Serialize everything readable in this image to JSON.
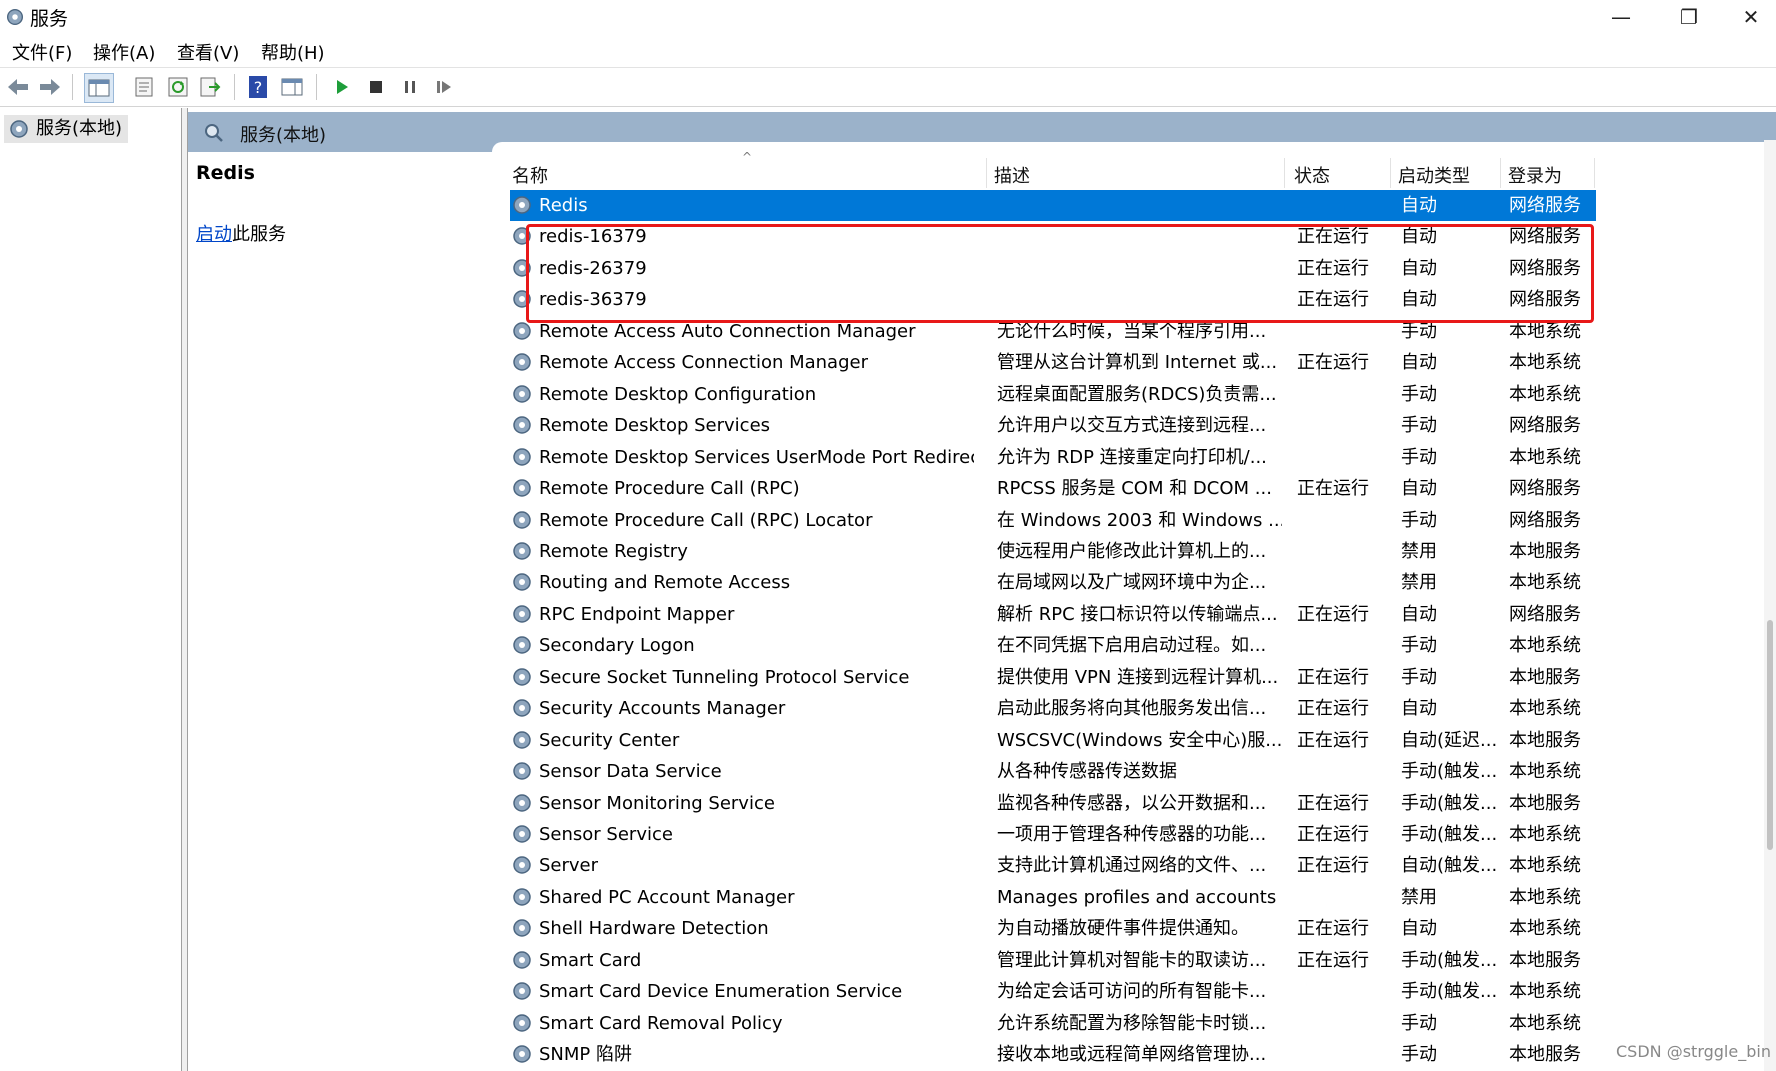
{
  "window": {
    "title": "服务",
    "minimize_glyph": "—",
    "restore_glyph": "❐",
    "close_glyph": "✕"
  },
  "menu": [
    "文件(F)",
    "操作(A)",
    "查看(V)",
    "帮助(H)"
  ],
  "toolbar_icons": [
    "back-icon",
    "forward-icon",
    "console-tree-icon",
    "properties-icon",
    "refresh-icon",
    "export-list-icon",
    "help-icon",
    "action-pane-icon",
    "start-service-icon",
    "stop-service-icon",
    "pause-service-icon",
    "resume-service-icon"
  ],
  "tree": {
    "root_label": "服务(本地)"
  },
  "pane": {
    "header_label": "服务(本地)"
  },
  "description": {
    "selected_service": "Redis",
    "action_link": "启动",
    "action_suffix": "此服务"
  },
  "columns": {
    "name": "名称",
    "desc": "描述",
    "status": "状态",
    "startup": "启动类型",
    "logon": "登录为"
  },
  "sort_indicator": "^",
  "services": [
    {
      "name": "Redis",
      "desc": "",
      "status": "",
      "startup": "自动",
      "logon": "网络服务",
      "selected": true
    },
    {
      "name": "redis-16379",
      "desc": "",
      "status": "正在运行",
      "startup": "自动",
      "logon": "网络服务"
    },
    {
      "name": "redis-26379",
      "desc": "",
      "status": "正在运行",
      "startup": "自动",
      "logon": "网络服务"
    },
    {
      "name": "redis-36379",
      "desc": "",
      "status": "正在运行",
      "startup": "自动",
      "logon": "网络服务"
    },
    {
      "name": "Remote Access Auto Connection Manager",
      "desc": "无论什么时候，当某个程序引用...",
      "status": "",
      "startup": "手动",
      "logon": "本地系统"
    },
    {
      "name": "Remote Access Connection Manager",
      "desc": "管理从这台计算机到 Internet 或...",
      "status": "正在运行",
      "startup": "自动",
      "logon": "本地系统"
    },
    {
      "name": "Remote Desktop Configuration",
      "desc": "远程桌面配置服务(RDCS)负责需...",
      "status": "",
      "startup": "手动",
      "logon": "本地系统"
    },
    {
      "name": "Remote Desktop Services",
      "desc": "允许用户以交互方式连接到远程...",
      "status": "",
      "startup": "手动",
      "logon": "网络服务"
    },
    {
      "name": "Remote Desktop Services UserMode Port Redirector",
      "desc": "允许为 RDP 连接重定向打印机/...",
      "status": "",
      "startup": "手动",
      "logon": "本地系统"
    },
    {
      "name": "Remote Procedure Call (RPC)",
      "desc": "RPCSS 服务是 COM 和 DCOM ...",
      "status": "正在运行",
      "startup": "自动",
      "logon": "网络服务"
    },
    {
      "name": "Remote Procedure Call (RPC) Locator",
      "desc": "在 Windows 2003 和 Windows ...",
      "status": "",
      "startup": "手动",
      "logon": "网络服务"
    },
    {
      "name": "Remote Registry",
      "desc": "使远程用户能修改此计算机上的...",
      "status": "",
      "startup": "禁用",
      "logon": "本地服务"
    },
    {
      "name": "Routing and Remote Access",
      "desc": "在局域网以及广域网环境中为企...",
      "status": "",
      "startup": "禁用",
      "logon": "本地系统"
    },
    {
      "name": "RPC Endpoint Mapper",
      "desc": "解析 RPC 接口标识符以传输端点...",
      "status": "正在运行",
      "startup": "自动",
      "logon": "网络服务"
    },
    {
      "name": "Secondary Logon",
      "desc": "在不同凭据下启用启动过程。如...",
      "status": "",
      "startup": "手动",
      "logon": "本地系统"
    },
    {
      "name": "Secure Socket Tunneling Protocol Service",
      "desc": "提供使用 VPN 连接到远程计算机...",
      "status": "正在运行",
      "startup": "手动",
      "logon": "本地服务"
    },
    {
      "name": "Security Accounts Manager",
      "desc": "启动此服务将向其他服务发出信...",
      "status": "正在运行",
      "startup": "自动",
      "logon": "本地系统"
    },
    {
      "name": "Security Center",
      "desc": "WSCSVC(Windows 安全中心)服...",
      "status": "正在运行",
      "startup": "自动(延迟...",
      "logon": "本地服务"
    },
    {
      "name": "Sensor Data Service",
      "desc": "从各种传感器传送数据",
      "status": "",
      "startup": "手动(触发...",
      "logon": "本地系统"
    },
    {
      "name": "Sensor Monitoring Service",
      "desc": "监视各种传感器，以公开数据和...",
      "status": "正在运行",
      "startup": "手动(触发...",
      "logon": "本地服务"
    },
    {
      "name": "Sensor Service",
      "desc": "一项用于管理各种传感器的功能...",
      "status": "正在运行",
      "startup": "手动(触发...",
      "logon": "本地系统"
    },
    {
      "name": "Server",
      "desc": "支持此计算机通过网络的文件、...",
      "status": "正在运行",
      "startup": "自动(触发...",
      "logon": "本地系统"
    },
    {
      "name": "Shared PC Account Manager",
      "desc": "Manages profiles and accounts o...",
      "status": "",
      "startup": "禁用",
      "logon": "本地系统"
    },
    {
      "name": "Shell Hardware Detection",
      "desc": "为自动播放硬件事件提供通知。",
      "status": "正在运行",
      "startup": "自动",
      "logon": "本地系统"
    },
    {
      "name": "Smart Card",
      "desc": "管理此计算机对智能卡的取读访...",
      "status": "正在运行",
      "startup": "手动(触发...",
      "logon": "本地服务"
    },
    {
      "name": "Smart Card Device Enumeration Service",
      "desc": "为给定会话可访问的所有智能卡...",
      "status": "",
      "startup": "手动(触发...",
      "logon": "本地系统"
    },
    {
      "name": "Smart Card Removal Policy",
      "desc": "允许系统配置为移除智能卡时锁...",
      "status": "",
      "startup": "手动",
      "logon": "本地系统"
    },
    {
      "name": "SNMP 陷阱",
      "desc": "接收本地或远程简单网络管理协...",
      "status": "",
      "startup": "手动",
      "logon": "本地服务"
    }
  ],
  "watermark": "CSDN @strggle_bin",
  "colors": {
    "selection": "#0078d7",
    "pane_header": "#9bb2ca",
    "highlight_box": "#e81818",
    "link": "#0046c8"
  }
}
